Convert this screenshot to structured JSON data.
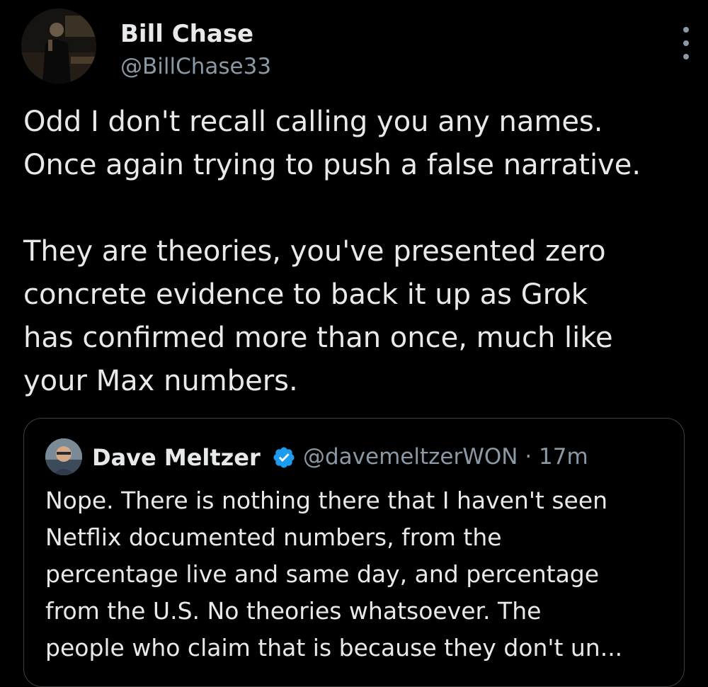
{
  "author": {
    "display_name": "Bill Chase",
    "handle": "@BillChase33",
    "avatar_icon": "profile-photo"
  },
  "tweet": {
    "paragraph1": [
      "Odd I don't recall calling you any names.",
      "Once again trying to push a false narrative."
    ],
    "paragraph2": [
      "They are theories, you've presented zero",
      "concrete evidence to back it up as Grok",
      "has confirmed more than once, much like",
      "your Max numbers."
    ]
  },
  "quoted_tweet": {
    "display_name": "Dave Meltzer",
    "handle_time": "@davemeltzerWON · 17m",
    "verified_color": "#1d9bf0",
    "text_lines": [
      "Nope.  There is nothing there that I haven't seen",
      "Netflix documented numbers, from the",
      "percentage live and same day, and percentage",
      "from the U.S.  No theories whatsoever.  The",
      "people who claim that is because they don't un..."
    ]
  },
  "colors": {
    "background": "#000000",
    "primary_text": "#e7e9ea",
    "secondary_text": "#8b98a5",
    "border": "#3a3f44"
  }
}
